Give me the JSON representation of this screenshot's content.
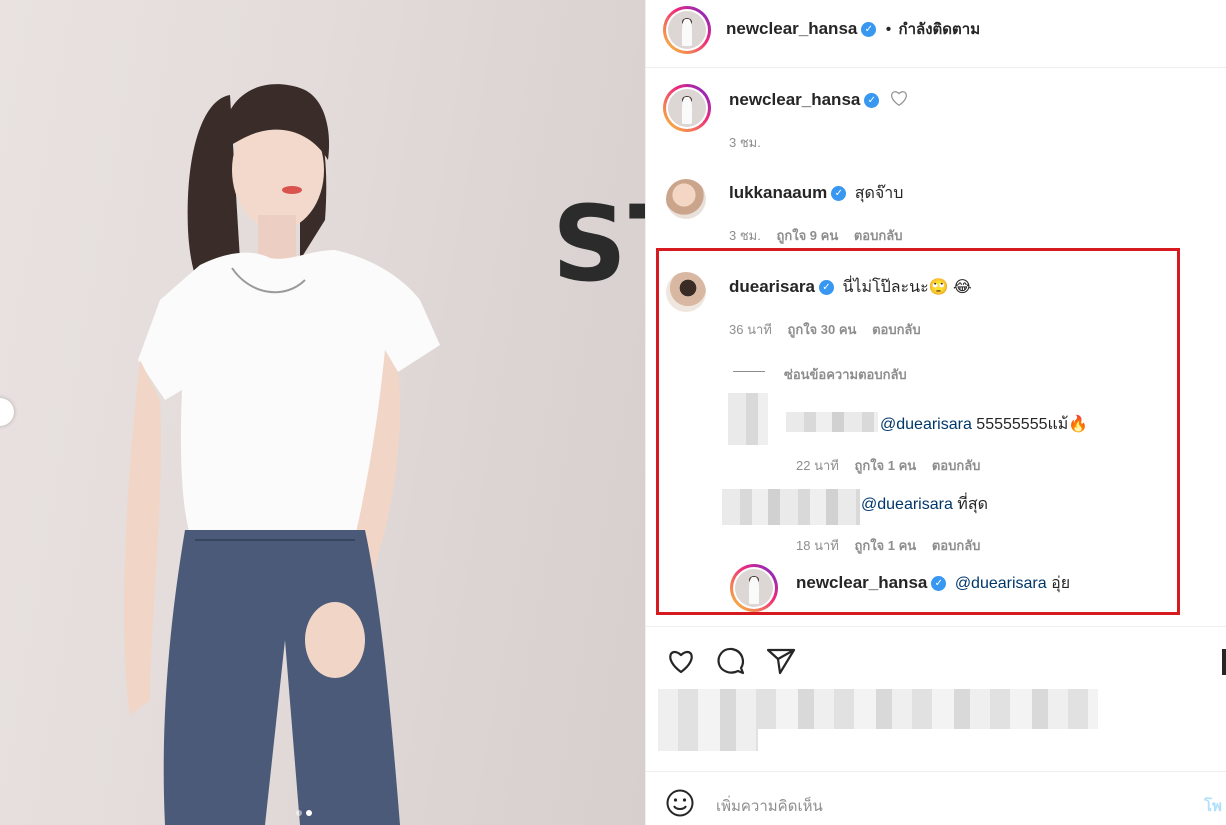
{
  "post": {
    "author": "newclear_hansa",
    "follow_sep": "•",
    "follow_status": "กำลังติดตาม",
    "wall_text": "ST"
  },
  "caption": {
    "user": "newclear_hansa",
    "time": "3 ชม."
  },
  "comments": [
    {
      "user": "lukkanaaum",
      "text": "สุดจ๊าบ",
      "time": "3 ชม.",
      "likes": "ถูกใจ 9 คน",
      "reply": "ตอบกลับ"
    },
    {
      "user": "duearisara",
      "text": "นี่ไม่โป๊ละนะ🙄 😂",
      "time": "36 นาที",
      "likes": "ถูกใจ 30 คน",
      "reply": "ตอบกลับ"
    }
  ],
  "hide_replies": "ซ่อนข้อความตอบกลับ",
  "replies": [
    {
      "mention": "@duearisara",
      "text": "55555555แม้🔥",
      "time": "22 นาที",
      "likes": "ถูกใจ 1 คน",
      "reply": "ตอบกลับ"
    },
    {
      "mention": "@duearisara",
      "text": "ที่สุด",
      "time": "18 นาที",
      "likes": "ถูกใจ 1 คน",
      "reply": "ตอบกลับ"
    },
    {
      "user": "newclear_hansa",
      "mention": "@duearisara",
      "text": "อุ่ย"
    }
  ],
  "footer": {
    "placeholder": "เพิ่มความคิดเห็น",
    "post_label": "โพ"
  },
  "icons": {
    "like": "heart-icon",
    "comment": "comment-icon",
    "share": "share-icon",
    "emoji": "emoji-icon"
  },
  "colors": {
    "highlight": "#d71920",
    "verified": "#3897f0",
    "mention": "#00376b"
  }
}
